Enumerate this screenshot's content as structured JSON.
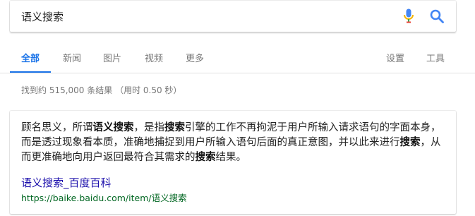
{
  "search": {
    "query": "语义搜索"
  },
  "tabs": [
    {
      "label": "全部",
      "active": true
    },
    {
      "label": "新闻"
    },
    {
      "label": "图片"
    },
    {
      "label": "视频"
    },
    {
      "label": "更多"
    }
  ],
  "tools": {
    "settings_label": "设置",
    "tools_label": "工具"
  },
  "stats": {
    "text": "找到约 515,000 条结果 （用时 0.50 秒）"
  },
  "snippet": {
    "segments": [
      {
        "text": "顾名思义，所谓",
        "bold": false
      },
      {
        "text": "语义搜索",
        "bold": true
      },
      {
        "text": "，是指",
        "bold": false
      },
      {
        "text": "搜索",
        "bold": true
      },
      {
        "text": "引擎的工作不再拘泥于用户所输入请求语句的字面本身，而是透过现象看本质，准确地捕捉到用户所输入语句后面的真正意图，并以此来进行",
        "bold": false
      },
      {
        "text": "搜索",
        "bold": true
      },
      {
        "text": "，从而更准确地向用户返回最符合其需求的",
        "bold": false
      },
      {
        "text": "搜索",
        "bold": true
      },
      {
        "text": "结果。",
        "bold": false
      }
    ]
  },
  "result": {
    "title": "语义搜索_百度百科",
    "url": "https://baike.baidu.com/item/语义搜索"
  },
  "colors": {
    "accent": "#1a73e8",
    "link": "#1a0dab",
    "url": "#006621",
    "muted": "#777777"
  },
  "icons": {
    "mic": "microphone-icon",
    "search": "search-icon"
  }
}
